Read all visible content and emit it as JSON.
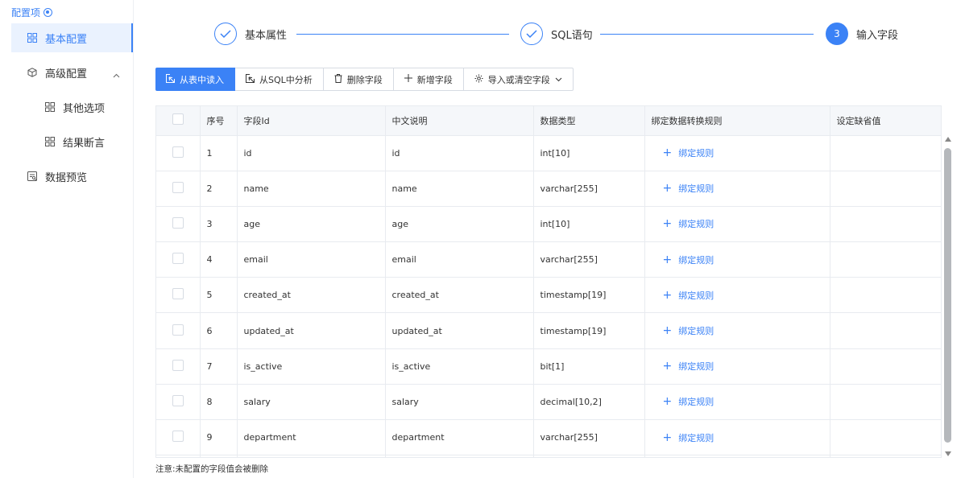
{
  "sidebar": {
    "header": "配置项",
    "items": [
      {
        "label": "基本配置",
        "icon": "grid-icon",
        "active": true
      },
      {
        "label": "高级配置",
        "icon": "cube-icon",
        "expanded": true
      },
      {
        "label": "其他选项",
        "icon": "grid-icon"
      },
      {
        "label": "结果断言",
        "icon": "grid-icon"
      },
      {
        "label": "数据预览",
        "icon": "preview-icon"
      }
    ]
  },
  "steps": [
    {
      "label": "基本属性",
      "status": "done"
    },
    {
      "label": "SQL语句",
      "status": "done"
    },
    {
      "number": "3",
      "label": "输入字段",
      "status": "current"
    }
  ],
  "toolbar": {
    "read_from_table": "从表中读入",
    "analyze_sql": "从SQL中分析",
    "delete_field": "删除字段",
    "add_field": "新增字段",
    "import_clear": "导入或清空字段"
  },
  "table": {
    "columns": [
      "序号",
      "字段Id",
      "中文说明",
      "数据类型",
      "绑定数据转换规则",
      "设定缺省值"
    ],
    "rows": [
      {
        "index": "1",
        "field_id": "id",
        "desc": "id",
        "type": "int[10]"
      },
      {
        "index": "2",
        "field_id": "name",
        "desc": "name",
        "type": "varchar[255]"
      },
      {
        "index": "3",
        "field_id": "age",
        "desc": "age",
        "type": "int[10]"
      },
      {
        "index": "4",
        "field_id": "email",
        "desc": "email",
        "type": "varchar[255]"
      },
      {
        "index": "5",
        "field_id": "created_at",
        "desc": "created_at",
        "type": "timestamp[19]"
      },
      {
        "index": "6",
        "field_id": "updated_at",
        "desc": "updated_at",
        "type": "timestamp[19]"
      },
      {
        "index": "7",
        "field_id": "is_active",
        "desc": "is_active",
        "type": "bit[1]"
      },
      {
        "index": "8",
        "field_id": "salary",
        "desc": "salary",
        "type": "decimal[10,2]"
      },
      {
        "index": "9",
        "field_id": "department",
        "desc": "department",
        "type": "varchar[255]"
      }
    ],
    "bind_rule_label": "绑定规则"
  },
  "note": "注意:未配置的字段值会被删除",
  "colors": {
    "accent": "#3b82f6",
    "border": "#e8ebf0",
    "header_bg": "#f5f7fa"
  }
}
